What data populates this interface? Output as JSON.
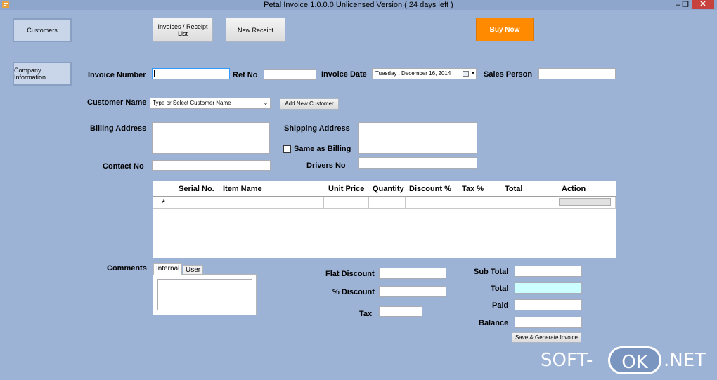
{
  "window": {
    "title": "Petal Invoice 1.0.0.0 Unlicensed Version ( 24 days left )",
    "minimize": "–",
    "restore": "❐",
    "close": "✕"
  },
  "nav": {
    "customers": "Customers",
    "company_information": "Company Information",
    "invoices_receipt_list": "Invoices / Receipt List",
    "new_receipt": "New Receipt",
    "buy_now": "Buy Now"
  },
  "form": {
    "invoice_number_label": "Invoice Number",
    "invoice_number_value": "",
    "ref_no_label": "Ref No",
    "ref_no_value": "",
    "invoice_date_label": "Invoice Date",
    "invoice_date_value": "Tuesday   , December 16, 2014",
    "sales_person_label": "Sales Person",
    "sales_person_value": "",
    "customer_name_label": "Customer Name",
    "customer_name_value": "Type or Select Customer Name",
    "add_new_customer": "Add New Customer",
    "billing_address_label": "Billing Address",
    "shipping_address_label": "Shipping Address",
    "same_as_billing_label": "Same as Billing",
    "same_as_billing_checked": false,
    "contact_no_label": "Contact No",
    "drivers_no_label": "Drivers No"
  },
  "grid": {
    "columns": [
      "Serial No.",
      "Item Name",
      "Unit Price",
      "Quantity",
      "Discount %",
      "Tax %",
      "Total",
      "Action"
    ],
    "new_row_marker": "*",
    "rows": []
  },
  "comments": {
    "label": "Comments",
    "tabs": [
      "Internal",
      "User"
    ],
    "active_tab": "Internal",
    "value": ""
  },
  "totals": {
    "flat_discount_label": "Flat Discount",
    "pct_discount_label": "% Discount",
    "tax_label": "Tax",
    "sub_total_label": "Sub Total",
    "total_label": "Total",
    "paid_label": "Paid",
    "balance_label": "Balance",
    "save_generate": "Save & Generate Invoice"
  },
  "watermark": {
    "left": "SOFT-",
    "badge": "OK",
    "right": ".NET"
  },
  "colors": {
    "background": "#9cb3d6",
    "buy_now": "#ff8a00",
    "total_field": "#ccffff",
    "close_button": "#c7423c"
  }
}
